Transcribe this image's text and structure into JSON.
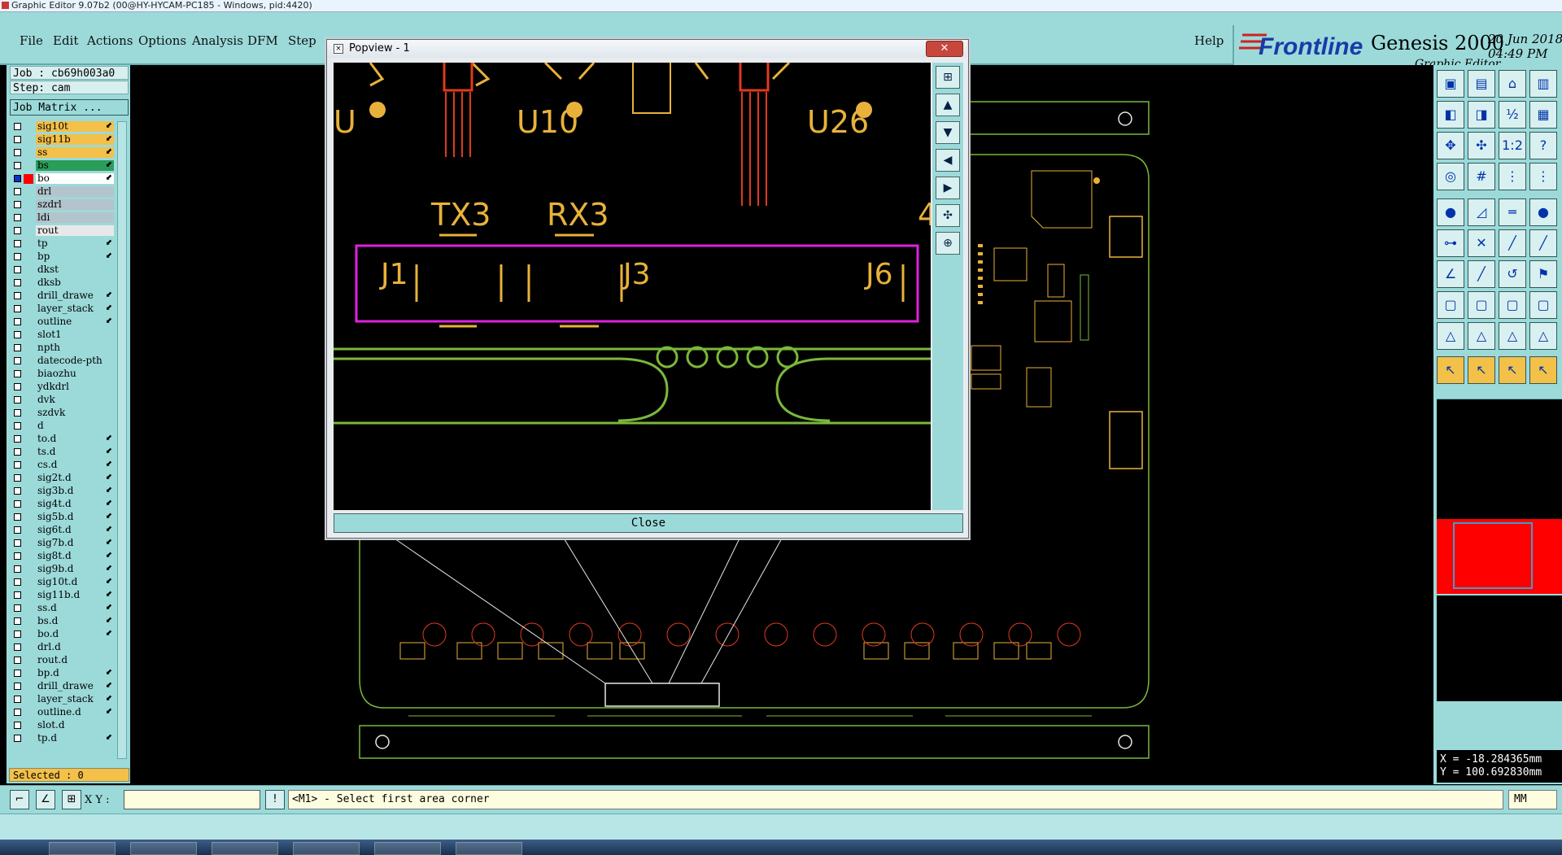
{
  "window": {
    "title": "Graphic Editor 9.07b2 (00@HY-HYCAM-PC185 - Windows, pid:4420)"
  },
  "menubar": {
    "items": [
      "File",
      "Edit",
      "Actions",
      "Options",
      "Analysis",
      "DFM",
      "Step"
    ],
    "help": "Help"
  },
  "brand": {
    "logo": "Frontline",
    "product": "Genesis 2000",
    "subtitle": "Graphic Editor",
    "date": "20 Jun 2018",
    "time": "04:49 PM"
  },
  "left_panel": {
    "job": "Job : cb69h003a0",
    "step": "Step: cam",
    "job_matrix": "Job Matrix ...",
    "layers": [
      {
        "name": "sig10t",
        "color": "#f3c049",
        "arrow": true
      },
      {
        "name": "sig11b",
        "color": "#f3c049",
        "arrow": true
      },
      {
        "name": "ss",
        "color": "#f3c049",
        "arrow": true
      },
      {
        "name": "bs",
        "color": "#2a9d5a",
        "arrow": true
      },
      {
        "name": "bo",
        "color": "#ffffff",
        "arrow": true,
        "active": true
      },
      {
        "name": "drl",
        "color": "#b4c4cc",
        "arrow": false
      },
      {
        "name": "szdrl",
        "color": "#b4c4cc",
        "arrow": false
      },
      {
        "name": "ldi",
        "color": "#b4c4cc",
        "arrow": false
      },
      {
        "name": "rout",
        "color": "#e8e8e8",
        "arrow": false
      },
      {
        "name": "tp",
        "color": "#9cdada",
        "arrow": true
      },
      {
        "name": "bp",
        "color": "#9cdada",
        "arrow": true
      },
      {
        "name": "dkst",
        "color": "#9cdada",
        "arrow": false
      },
      {
        "name": "dksb",
        "color": "#9cdada",
        "arrow": false
      },
      {
        "name": "drill_drawe",
        "color": "#9cdada",
        "arrow": true
      },
      {
        "name": "layer_stack",
        "color": "#9cdada",
        "arrow": true
      },
      {
        "name": "outline",
        "color": "#9cdada",
        "arrow": true
      },
      {
        "name": "slot1",
        "color": "#9cdada",
        "arrow": false
      },
      {
        "name": "npth",
        "color": "#9cdada",
        "arrow": false
      },
      {
        "name": "datecode-pth",
        "color": "#9cdada",
        "arrow": false
      },
      {
        "name": "biaozhu",
        "color": "#9cdada",
        "arrow": false
      },
      {
        "name": "ydkdrl",
        "color": "#9cdada",
        "arrow": false
      },
      {
        "name": "dvk",
        "color": "#9cdada",
        "arrow": false
      },
      {
        "name": "szdvk",
        "color": "#9cdada",
        "arrow": false
      },
      {
        "name": "d",
        "color": "#9cdada",
        "arrow": false
      },
      {
        "name": "to.d",
        "color": "#9cdada",
        "arrow": true
      },
      {
        "name": "ts.d",
        "color": "#9cdada",
        "arrow": true
      },
      {
        "name": "cs.d",
        "color": "#9cdada",
        "arrow": true
      },
      {
        "name": "sig2t.d",
        "color": "#9cdada",
        "arrow": true
      },
      {
        "name": "sig3b.d",
        "color": "#9cdada",
        "arrow": true
      },
      {
        "name": "sig4t.d",
        "color": "#9cdada",
        "arrow": true
      },
      {
        "name": "sig5b.d",
        "color": "#9cdada",
        "arrow": true
      },
      {
        "name": "sig6t.d",
        "color": "#9cdada",
        "arrow": true
      },
      {
        "name": "sig7b.d",
        "color": "#9cdada",
        "arrow": true
      },
      {
        "name": "sig8t.d",
        "color": "#9cdada",
        "arrow": true
      },
      {
        "name": "sig9b.d",
        "color": "#9cdada",
        "arrow": true
      },
      {
        "name": "sig10t.d",
        "color": "#9cdada",
        "arrow": true
      },
      {
        "name": "sig11b.d",
        "color": "#9cdada",
        "arrow": true
      },
      {
        "name": "ss.d",
        "color": "#9cdada",
        "arrow": true
      },
      {
        "name": "bs.d",
        "color": "#9cdada",
        "arrow": true
      },
      {
        "name": "bo.d",
        "color": "#9cdada",
        "arrow": true
      },
      {
        "name": "drl.d",
        "color": "#9cdada",
        "arrow": false
      },
      {
        "name": "rout.d",
        "color": "#9cdada",
        "arrow": false
      },
      {
        "name": "bp.d",
        "color": "#9cdada",
        "arrow": true
      },
      {
        "name": "drill_drawe",
        "color": "#9cdada",
        "arrow": true
      },
      {
        "name": "layer_stack",
        "color": "#9cdada",
        "arrow": true
      },
      {
        "name": "outline.d",
        "color": "#9cdada",
        "arrow": true
      },
      {
        "name": "slot.d",
        "color": "#9cdada",
        "arrow": false
      },
      {
        "name": "tp.d",
        "color": "#9cdada",
        "arrow": true
      }
    ],
    "selected": "Selected : 0"
  },
  "popup": {
    "title": "Popview - 1",
    "close_label": "Close",
    "labels": [
      "U",
      "U10",
      "U26",
      "TX3",
      "RX3",
      "J1",
      "J3",
      "J6",
      "4"
    ]
  },
  "status": {
    "xy_label": "X Y :",
    "xy_value": "",
    "hint": "<M1> - Select first area corner",
    "units": "MM",
    "x": "X = -18.284365mm",
    "y": "Y = 100.692830mm"
  },
  "colors": {
    "panel": "#9cdada",
    "pcb_yellow": "#e8b23a",
    "pcb_green": "#7ab83a",
    "pcb_red": "#e03a1e",
    "highlight": "#e020e0"
  }
}
